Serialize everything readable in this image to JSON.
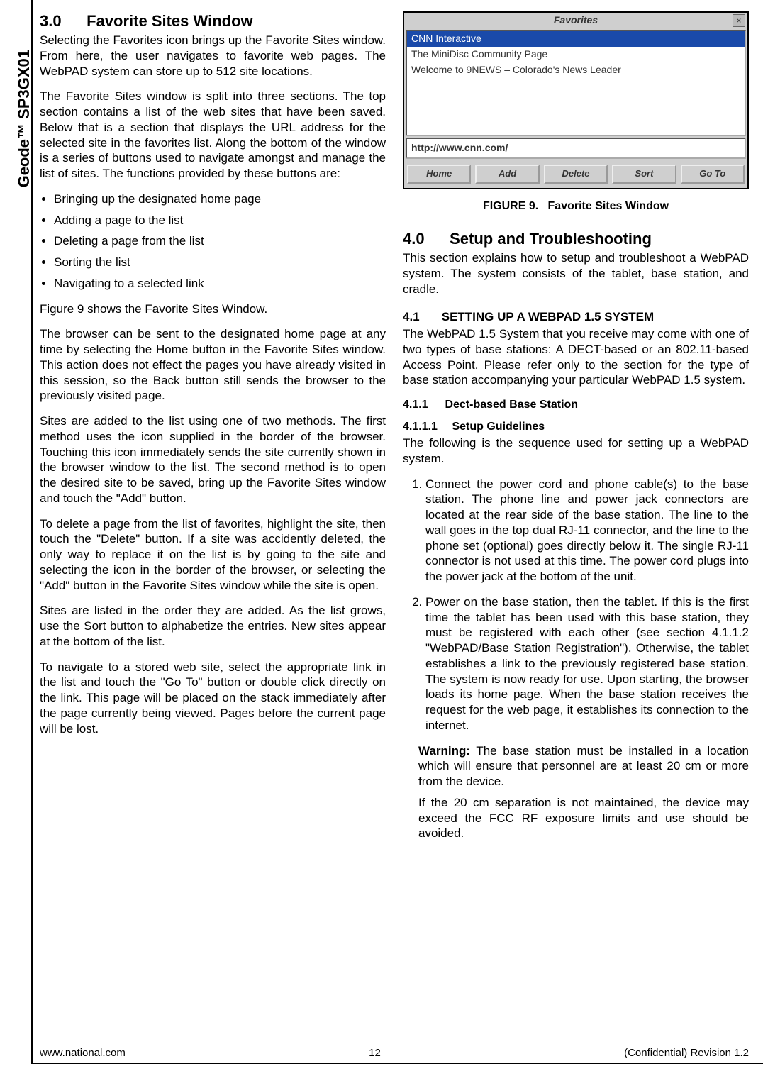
{
  "side_label": "Geode™ SP3GX01",
  "left": {
    "section_num": "3.0",
    "section_title": "Favorite Sites Window",
    "p1": "Selecting the Favorites icon brings up the Favorite Sites window. From here, the user navigates to favorite web pages. The WebPAD system can store up to 512 site locations.",
    "p2": "The Favorite Sites window is split into three sections. The top section contains a list of the web sites that have been saved. Below that is a section that displays the URL address for the selected site in the favorites list. Along the bottom of the window is a series of buttons used to navigate amongst and manage the list of sites. The functions provided by these buttons are:",
    "bullets": [
      "Bringing up the designated home page",
      "Adding a page to the list",
      "Deleting a page from the list",
      "Sorting the list",
      "Navigating to a selected link"
    ],
    "p3": "Figure 9 shows the Favorite Sites Window.",
    "p4": "The browser can be sent to the designated home page at any time by selecting the Home button in the Favorite Sites window. This action does not effect the pages you have already visited in this session, so the Back button still sends the browser to the previously visited page.",
    "p5": "Sites are added to the list using one of two methods. The first method uses the icon supplied in the border of the browser. Touching this icon immediately sends the site currently shown in the browser window to the list. The second method is to open the desired site to be saved, bring up the Favorite Sites window and touch the \"Add\" button.",
    "p6": "To delete a page from the list of favorites, highlight the site, then touch the \"Delete\" button. If a site was accidently deleted, the only way to replace it on the list is by going to the site and selecting the icon in the border of the browser, or selecting the \"Add\" button in the Favorite Sites window while the site is open.",
    "p7": "Sites are listed in the order they are added. As the list grows, use the Sort button to alphabetize the entries. New sites appear at the bottom of the list.",
    "p8": "To navigate to a stored web site, select the appropriate link in the list and touch the \"Go To\" button or double click directly on the link. This page will be placed on the stack immediately after the page currently being viewed. Pages before the current page will be lost."
  },
  "figure": {
    "title": "Favorites",
    "items": [
      {
        "label": "CNN Interactive",
        "selected": true
      },
      {
        "label": "The MiniDisc Community Page",
        "selected": false
      },
      {
        "label": "Welcome to 9NEWS – Colorado's News Leader",
        "selected": false
      }
    ],
    "url": "http://www.cnn.com/",
    "buttons": [
      "Home",
      "Add",
      "Delete",
      "Sort",
      "Go To"
    ],
    "caption_label": "FIGURE 9.",
    "caption_text": "Favorite Sites Window"
  },
  "right": {
    "section_num": "4.0",
    "section_title": "Setup and Troubleshooting",
    "p1": "This section explains how to setup and troubleshoot a WebPAD system. The system consists of the tablet, base station, and cradle.",
    "sub1_num": "4.1",
    "sub1_title": "SETTING UP A WEBPAD 1.5 SYSTEM",
    "p2": "The WebPAD 1.5 System that you receive may come with one of two types of base stations: A DECT-based or an 802.11-based Access Point. Please refer only to the section for the type of base station accompanying your particular WebPAD 1.5 system.",
    "sub2_num": "4.1.1",
    "sub2_title": "Dect-based Base Station",
    "sub3_num": "4.1.1.1",
    "sub3_title": "Setup Guidelines",
    "p3": "The following is the sequence used for setting up a WebPAD system.",
    "steps": [
      "Connect the power cord and phone cable(s) to the base station. The phone line and power jack connectors are located at the rear side of the base station. The line to the wall goes in the top dual RJ-11 connector, and the line to the phone set (optional) goes directly below it. The single RJ-11 connector is not used at this time. The power cord plugs into the power jack at the bottom of the unit.",
      "Power on the base station, then the tablet. If this is the first time the tablet has been used with this base station, they must be registered with each other (see section 4.1.1.2 \"WebPAD/Base Station Registration\"). Otherwise, the tablet establishes a link to the previously registered base station. The system is now ready for use. Upon starting, the browser loads its home page. When the base station receives the request for the web page, it establishes its connection to the internet."
    ],
    "warning_label": "Warning:",
    "warning_text": " The base station must be installed in a location which will ensure that personnel are at least 20 cm or more from the device.",
    "warning_sub": "If the 20 cm separation is not maintained, the device may exceed the FCC RF exposure limits and use should be avoided."
  },
  "footer": {
    "left": "www.national.com",
    "center": "12",
    "right": "(Confidential) Revision 1.2"
  }
}
